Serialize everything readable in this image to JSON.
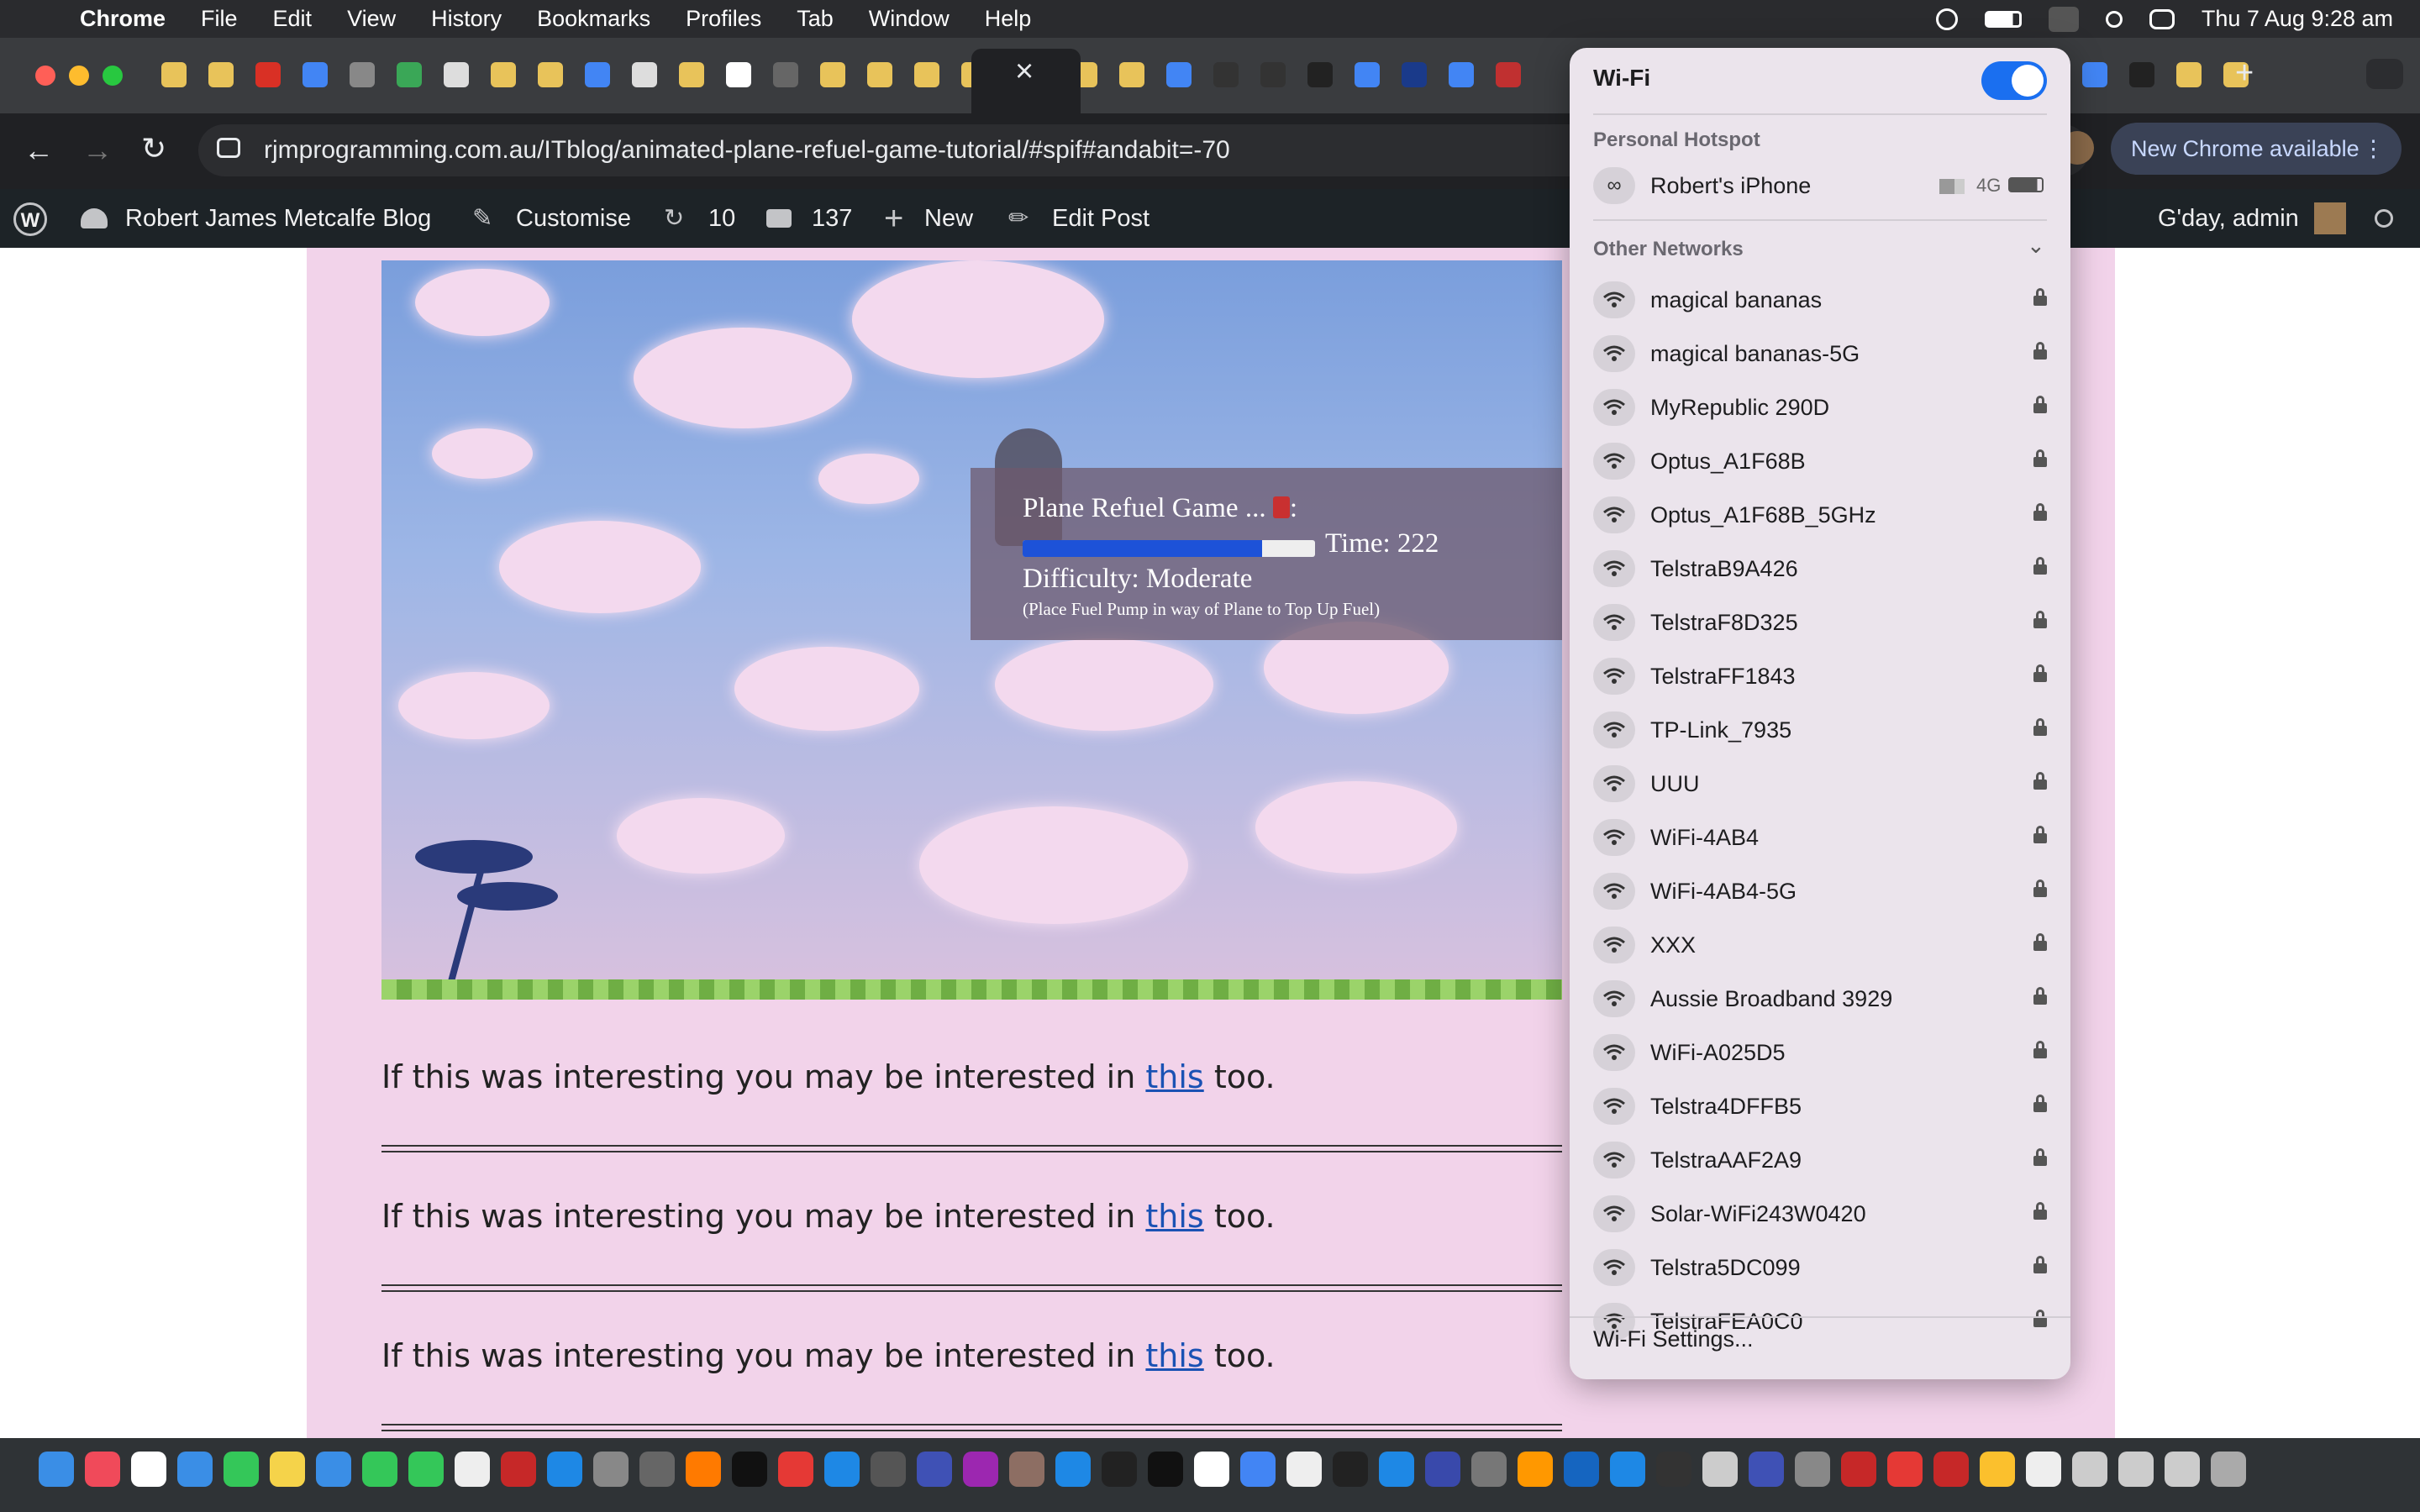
{
  "menubar": {
    "app": "Chrome",
    "items": [
      "File",
      "Edit",
      "View",
      "History",
      "Bookmarks",
      "Profiles",
      "Tab",
      "Window",
      "Help"
    ],
    "clock": "Thu 7 Aug  9:28 am"
  },
  "browser": {
    "url": "rjmprogramming.com.au/ITblog/animated-plane-refuel-game-tutorial/#spif#andabit=-70",
    "new_chrome": "New Chrome available",
    "close_tab": "×",
    "new_tab": "+"
  },
  "wp_admin_bar": {
    "site_name": "Robert James Metcalfe Blog",
    "customise": "Customise",
    "updates": "10",
    "comments": "137",
    "new": "New",
    "edit_post": "Edit Post",
    "greeting": "G'day, admin"
  },
  "game": {
    "title": "Plane Refuel Game ... ",
    "title_suffix": ":",
    "fuel_level": 0.82,
    "time_label": "Time: 222",
    "difficulty": "Difficulty: Moderate",
    "instruction": "(Place Fuel Pump in way of Plane to Top Up Fuel)"
  },
  "page": {
    "para_prefix": "If this was interesting you may be interested in ",
    "link_text": "this",
    "para_suffix": " too."
  },
  "wifi": {
    "title": "Wi-Fi",
    "enabled": true,
    "personal_hotspot_label": "Personal Hotspot",
    "hotspot": {
      "name": "Robert's iPhone",
      "network_type": "4G"
    },
    "other_networks_label": "Other Networks",
    "networks": [
      "magical bananas",
      "magical bananas-5G",
      "MyRepublic 290D",
      "Optus_A1F68B",
      "Optus_A1F68B_5GHz",
      "TelstraB9A426",
      "TelstraF8D325",
      "TelstraFF1843",
      "TP-Link_7935",
      "UUU",
      "WiFi-4AB4",
      "WiFi-4AB4-5G",
      "XXX",
      "Aussie Broadband 3929",
      "WiFi-A025D5",
      "Telstra4DFFB5",
      "TelstraAAF2A9",
      "Solar-WiFi243W0420",
      "Telstra5DC099",
      "TelstraFEA0C0"
    ],
    "settings_label": "Wi-Fi Settings..."
  },
  "colors": {
    "accent_blue": "#1a6ff0",
    "wp_bar": "#1d2327",
    "page_pink": "#f2d3ea",
    "link": "#1a52b4"
  },
  "icons": {
    "apple": "apple-icon",
    "wifi": "wifi-icon",
    "lock": "lock-icon",
    "hotspot": "link-icon",
    "search": "search-icon"
  }
}
